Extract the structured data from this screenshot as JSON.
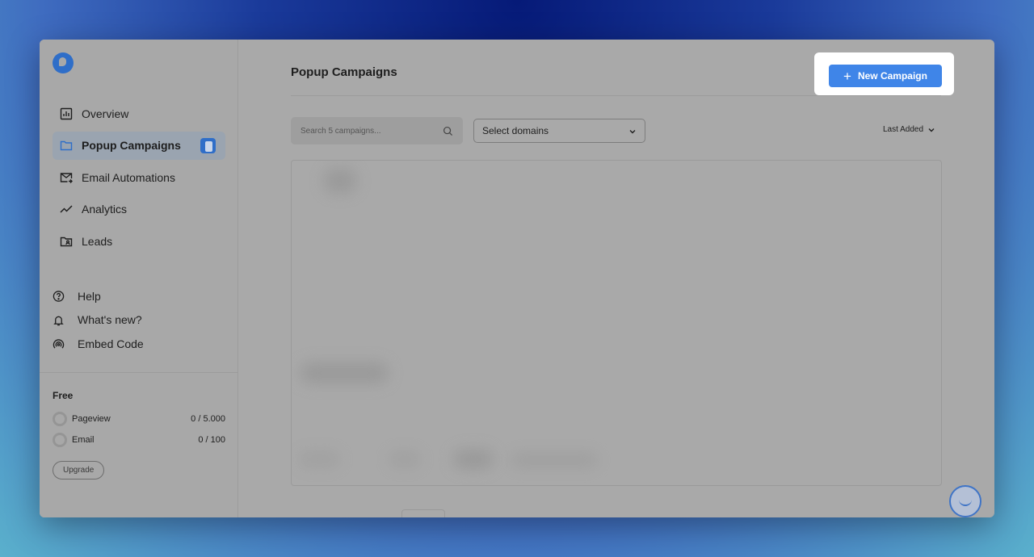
{
  "sidebar": {
    "nav": [
      {
        "label": "Overview",
        "icon": "chart-icon",
        "active": false
      },
      {
        "label": "Popup Campaigns",
        "icon": "folder-icon",
        "active": true
      },
      {
        "label": "Email Automations",
        "icon": "mail-icon",
        "active": false
      },
      {
        "label": "Analytics",
        "icon": "trend-icon",
        "active": false
      },
      {
        "label": "Leads",
        "icon": "contact-folder-icon",
        "active": false
      }
    ],
    "links": [
      {
        "label": "Help",
        "icon": "help-icon"
      },
      {
        "label": "What's new?",
        "icon": "bell-icon"
      },
      {
        "label": "Embed Code",
        "icon": "broadcast-icon"
      }
    ],
    "plan": {
      "title": "Free",
      "usage": [
        {
          "label": "Pageview",
          "value": "0 / 5.000"
        },
        {
          "label": "Email",
          "value": "0 / 100"
        }
      ],
      "upgrade_label": "Upgrade"
    }
  },
  "main": {
    "title": "Popup Campaigns",
    "new_campaign_label": "New Campaign",
    "search_placeholder": "Search 5 campaigns...",
    "domains_select": "Select domains",
    "sort_label": "Last Added"
  },
  "colors": {
    "accent": "#3f85e8",
    "brand": "#2f6ec8"
  }
}
